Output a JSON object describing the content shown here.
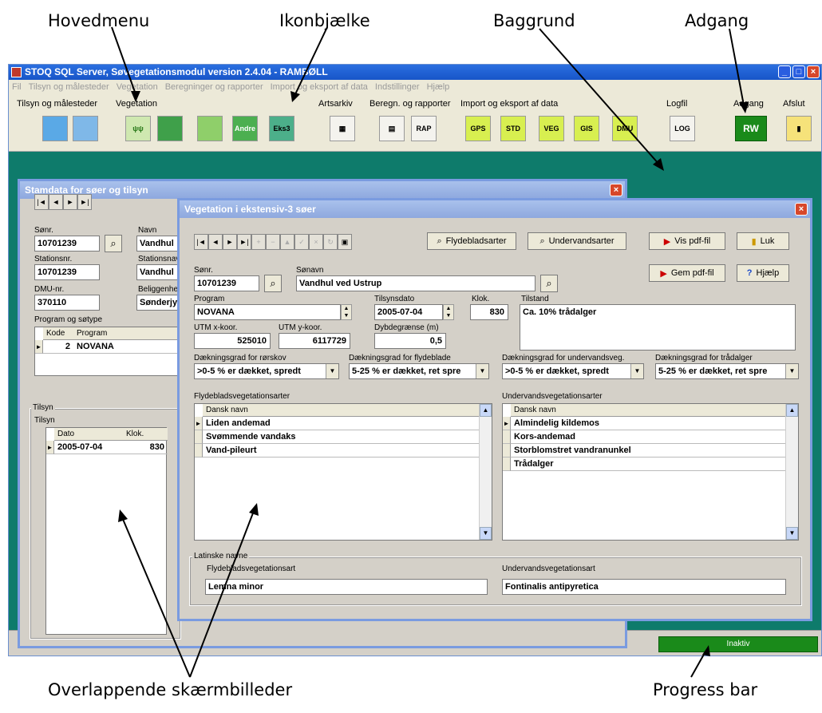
{
  "annotations": {
    "hovedmenu": "Hovedmenu",
    "ikonbjaelke": "Ikonbjælke",
    "baggrund": "Baggrund",
    "adgang": "Adgang",
    "overlappende": "Overlappende skærmbilleder",
    "progress": "Progress bar"
  },
  "app": {
    "title": "STOQ SQL Server, Søvegetationsmodul version 2.4.04 - RAMBØLL",
    "menu": [
      "Fil",
      "Tilsyn og målesteder",
      "Vegetation",
      "Beregninger og rapporter",
      "Import og eksport af data",
      "Indstillinger",
      "Hjælp"
    ],
    "toolbar_groups": {
      "tilsyn": "Tilsyn og målesteder",
      "vegetation": "Vegetation",
      "artsarkiv": "Artsarkiv",
      "beregn": "Beregn. og rapporter",
      "import": "Import og eksport af data",
      "logfil": "Logfil",
      "adgang": "Adgang",
      "afslut": "Afslut"
    },
    "toolbar_icon_labels": {
      "andre": "Andre",
      "eks3": "Eks3",
      "rap": "RAP",
      "gps": "GPS",
      "std": "STD",
      "veg": "VEG",
      "gis": "GIS",
      "dmu": "DMU",
      "log": "LOG",
      "rw": "RW"
    },
    "status": {
      "progress_text": "Inaktiv",
      "progress": 1.0
    }
  },
  "stamdata": {
    "title": "Stamdata for søer og tilsyn",
    "labels": {
      "sonr": "Sønr.",
      "navn": "Navn",
      "stationsnr": "Stationsnr.",
      "stationsnavn": "Stationsnav",
      "dmunr": "DMU-nr.",
      "beliggenhed": "Beliggenhe",
      "program": "Program og søtype",
      "tilsyn_frame": "Tilsyn",
      "tilsyn_grid": "Tilsyn"
    },
    "values": {
      "sonr": "10701239",
      "navn": "Vandhul",
      "stationsnr": "10701239",
      "stationsnavn": "Vandhul",
      "dmunr": "370110",
      "beliggenhed": "Sønderjy"
    },
    "program_grid": {
      "headers": [
        "Kode",
        "Program"
      ],
      "rows": [
        [
          "2",
          "NOVANA"
        ]
      ]
    },
    "tilsyn_grid": {
      "headers": [
        "Dato",
        "Klok."
      ],
      "rows": [
        [
          "2005-07-04",
          "830"
        ]
      ]
    }
  },
  "veg": {
    "title": "Vegetation i ekstensiv-3 søer",
    "buttons": {
      "flydeblad": "Flydebladsarter",
      "undervand": "Undervandsarter",
      "vispdf": "Vis pdf-fil",
      "luk": "Luk",
      "gempdf": "Gem pdf-fil",
      "hjaelp": "Hjælp"
    },
    "labels": {
      "sonr": "Sønr.",
      "sonavn": "Sønavn",
      "program": "Program",
      "tilsynsdato": "Tilsynsdato",
      "klok": "Klok.",
      "tilstand": "Tilstand",
      "utmx": "UTM x-koor.",
      "utmy": "UTM y-koor.",
      "dybde": "Dybdegrænse (m)",
      "d1": "Dækningsgrad for rørskov",
      "d2": "Dækningsgrad for flydeblade",
      "d3": "Dækningsgrad for undervandsveg.",
      "d4": "Dækningsgrad for trådalger",
      "flyde_list": "Flydebladsvegetationsarter",
      "under_list": "Undervandsvegetationsarter",
      "latin_frame": "Latinske navne",
      "latin_flyde": "Flydebladsvegetationsart",
      "latin_under": "Undervandsvegetationsart"
    },
    "values": {
      "sonr": "10701239",
      "sonavn": "Vandhul ved Ustrup",
      "program": "NOVANA",
      "tilsynsdato": "2005-07-04",
      "klok": "830",
      "tilstand": "Ca. 10% trådalger",
      "utmx": "525010",
      "utmy": "6117729",
      "dybde": "0,5",
      "d1": ">0-5 % er dækket, spredt",
      "d2": "5-25 % er dækket, ret spre",
      "d3": ">0-5 % er dækket, spredt",
      "d4": "5-25 % er dækket, ret spre",
      "latin_flyde": "Lemna minor",
      "latin_under": "Fontinalis antipyretica"
    },
    "flyde_grid": {
      "header": "Dansk navn",
      "rows": [
        "Liden andemad",
        "Svømmende vandaks",
        "Vand-pileurt"
      ]
    },
    "under_grid": {
      "header": "Dansk navn",
      "rows": [
        "Almindelig kildemos",
        "Kors-andemad",
        "Storblomstret vandranunkel",
        "Trådalger"
      ]
    }
  }
}
